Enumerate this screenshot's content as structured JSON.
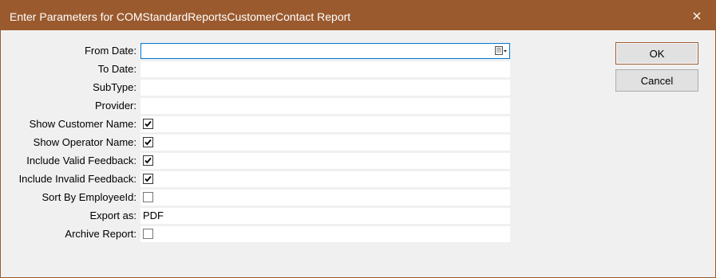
{
  "window": {
    "title": "Enter Parameters for COMStandardReportsCustomerContact Report"
  },
  "colors": {
    "titlebar": "#9a5a2e",
    "focus_border": "#0078d7",
    "background": "#f0f0f0"
  },
  "icons": {
    "close": "close-icon",
    "date_picker": "calendar-dropdown-icon"
  },
  "params": {
    "from_date": {
      "label": "From Date:",
      "value": ""
    },
    "to_date": {
      "label": "To Date:",
      "value": ""
    },
    "subtype": {
      "label": "SubType:",
      "value": ""
    },
    "provider": {
      "label": "Provider:",
      "value": ""
    },
    "show_customer_name": {
      "label": "Show Customer Name:",
      "checked": true
    },
    "show_operator_name": {
      "label": "Show Operator Name:",
      "checked": true
    },
    "include_valid_feedback": {
      "label": "Include Valid Feedback:",
      "checked": true
    },
    "include_invalid_feedback": {
      "label": "Include Invalid Feedback:",
      "checked": true
    },
    "sort_by_employeeid": {
      "label": "Sort By EmployeeId:",
      "checked": false
    },
    "export_as": {
      "label": "Export as:",
      "value": "PDF"
    },
    "archive_report": {
      "label": "Archive Report:",
      "checked": false
    }
  },
  "buttons": {
    "ok": "OK",
    "cancel": "Cancel"
  }
}
